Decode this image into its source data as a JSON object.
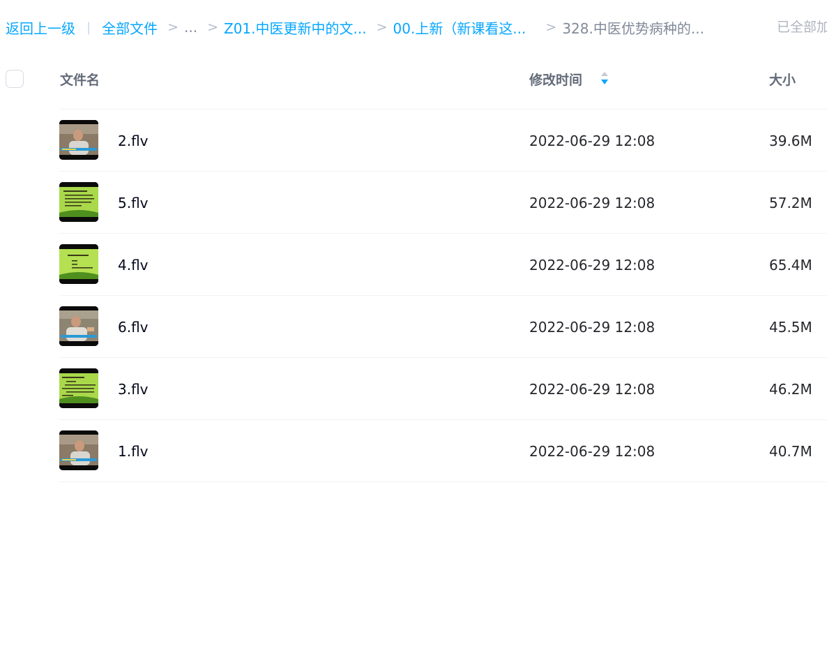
{
  "breadcrumb": {
    "back_label": "返回上一级",
    "pipe": "|",
    "separator": ">",
    "items": [
      {
        "label": "全部文件"
      },
      {
        "label": "..."
      },
      {
        "label": "Z01.中医更新中的文..."
      },
      {
        "label": "00.上新（新课看这..."
      },
      {
        "label": "328.中医优势病种的..."
      }
    ],
    "status": "已全部加载"
  },
  "table": {
    "columns": {
      "name": "文件名",
      "time": "修改时间",
      "size": "大小"
    },
    "sort": {
      "column": "time",
      "direction": "desc",
      "icon": "sort-icon"
    },
    "accent_color": "#06a7ff",
    "rows": [
      {
        "name": "2.flv",
        "time": "2022-06-29 12:08",
        "size": "39.6M",
        "thumbnail": "video-lecture-person"
      },
      {
        "name": "5.flv",
        "time": "2022-06-29 12:08",
        "size": "57.2M",
        "thumbnail": "video-green-slide"
      },
      {
        "name": "4.flv",
        "time": "2022-06-29 12:08",
        "size": "65.4M",
        "thumbnail": "video-green-slide"
      },
      {
        "name": "6.flv",
        "time": "2022-06-29 12:08",
        "size": "45.5M",
        "thumbnail": "video-lecture-person"
      },
      {
        "name": "3.flv",
        "time": "2022-06-29 12:08",
        "size": "46.2M",
        "thumbnail": "video-green-slide"
      },
      {
        "name": "1.flv",
        "time": "2022-06-29 12:08",
        "size": "40.7M",
        "thumbnail": "video-lecture-person"
      }
    ]
  }
}
